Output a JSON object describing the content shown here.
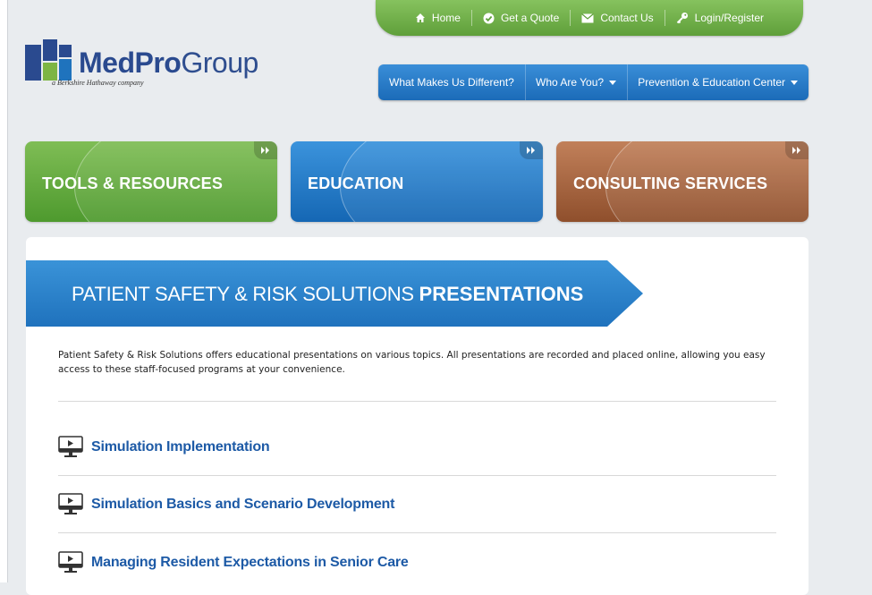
{
  "utility_nav": {
    "home": "Home",
    "quote": "Get a Quote",
    "contact": "Contact Us",
    "login": "Login/Register"
  },
  "logo": {
    "bold": "MedPro",
    "light": "Group",
    "tagline": "a Berkshire Hathaway company"
  },
  "main_nav": {
    "item1": "What Makes Us Different?",
    "item2": "Who Are You?",
    "item3": "Prevention & Education Center"
  },
  "tiles": {
    "tools": "TOOLS & RESOURCES",
    "education": "EDUCATION",
    "consulting": "CONSULTING SERVICES"
  },
  "banner": {
    "light": "PATIENT SAFETY & RISK SOLUTIONS ",
    "bold": "PRESENTATIONS"
  },
  "intro": "Patient Safety & Risk Solutions offers educational presentations on various topics. All presentations are recorded and placed online, allowing you easy access to these staff-focused programs at your convenience.",
  "presentations": {
    "p1": "Simulation Implementation",
    "p2": "Simulation Basics and Scenario Development",
    "p3": "Managing Resident Expectations in Senior Care"
  },
  "colors": {
    "green": "#5f9f3a",
    "blue": "#1f72bd",
    "brown": "#8f4f2c",
    "link": "#1d5aa6"
  }
}
